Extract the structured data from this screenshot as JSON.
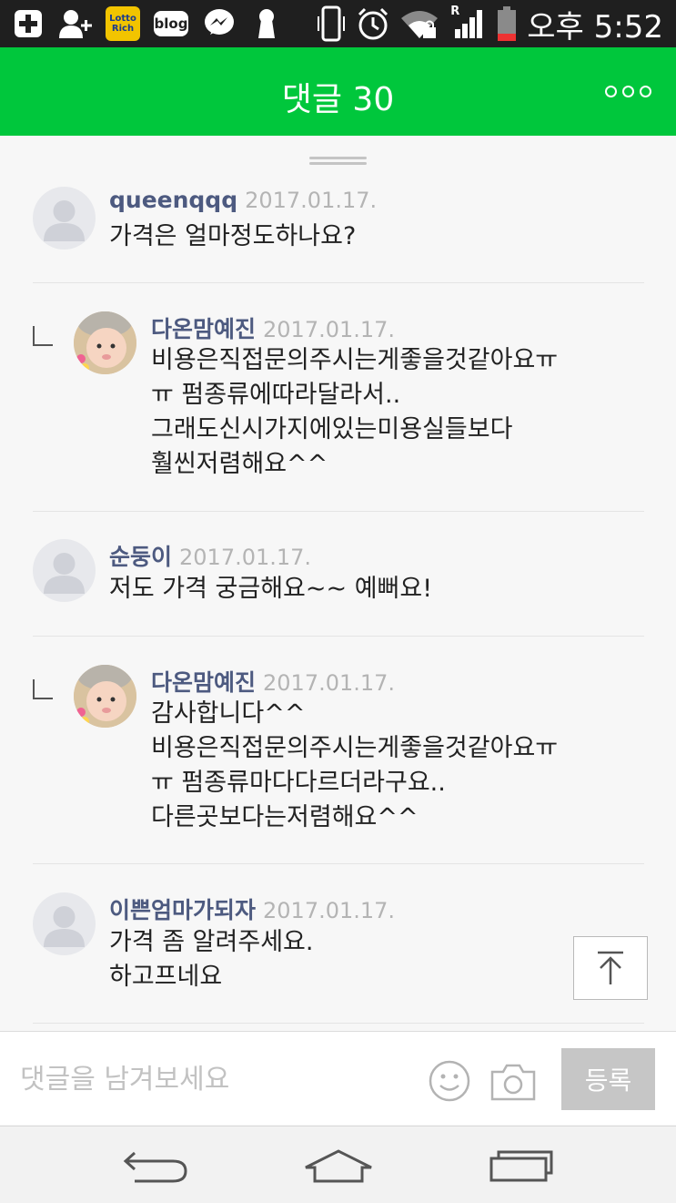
{
  "status_bar": {
    "time": "오후 5:52",
    "left_icons": [
      "add-icon",
      "add-person-icon",
      "lotto-rich-app-icon",
      "blog-icon",
      "messenger-icon",
      "keyhole-icon"
    ],
    "right_icons": [
      "phone-vibrate-icon",
      "alarm-icon",
      "wifi-lock-icon",
      "signal-icon",
      "battery-icon"
    ],
    "lotto_label": "Lotto Rich",
    "blog_label": "blog",
    "roaming_label": "R"
  },
  "header": {
    "title": "댓글 30",
    "more_icon": "more-icon"
  },
  "comments": [
    {
      "author": "queenqqq",
      "date": "2017.01.17.",
      "text": "가격은 얼마정도하나요?",
      "reply": false,
      "avatar": "default"
    },
    {
      "author": "다온맘예진",
      "date": "2017.01.17.",
      "text": "비용은직접문의주시는게좋을것같아요ㅠ\nㅠ 펌종류에따라달라서..\n그래도신시가지에있는미용실들보다\n훨씬저렴해요^^",
      "reply": true,
      "avatar": "photo"
    },
    {
      "author": "순둥이",
      "date": "2017.01.17.",
      "text": "저도 가격 궁금해요~~ 예뻐요!",
      "reply": false,
      "avatar": "default"
    },
    {
      "author": "다온맘예진",
      "date": "2017.01.17.",
      "text": "감사합니다^^\n비용은직접문의주시는게좋을것같아요ㅠ\nㅠ 펌종류마다다르더라구요..\n다른곳보다는저렴해요^^",
      "reply": true,
      "avatar": "photo"
    },
    {
      "author": "이쁜엄마가되자",
      "date": "2017.01.17.",
      "text": "가격 좀 알려주세요.\n하고프네요",
      "reply": false,
      "avatar": "default"
    }
  ],
  "input": {
    "placeholder": "댓글을 남겨보세요",
    "value": "",
    "submit_label": "등록"
  },
  "colors": {
    "accent": "#00c73c",
    "author": "#4d5a80",
    "date": "#b4b4b4",
    "submit_disabled": "#c6c6c6"
  },
  "nav": {
    "icons": [
      "back-icon",
      "home-icon",
      "recent-apps-icon"
    ]
  }
}
